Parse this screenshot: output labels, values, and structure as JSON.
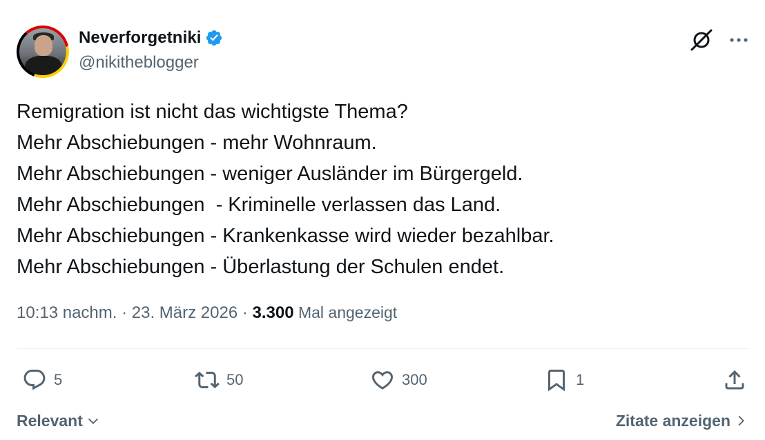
{
  "author": {
    "display_name": "Neverforgetniki",
    "handle": "@nikitheblogger",
    "verified": true
  },
  "tweet": {
    "lines": [
      "Remigration ist nicht das wichtigste Thema?",
      "Mehr Abschiebungen - mehr Wohnraum.",
      "Mehr Abschiebungen - weniger Ausländer im Bürgergeld.",
      "Mehr Abschiebungen  - Kriminelle verlassen das Land.",
      "Mehr Abschiebungen - Krankenkasse wird wieder bezahlbar.",
      "Mehr Abschiebungen - Überlastung der Schulen endet."
    ]
  },
  "meta": {
    "time": "10:13 nachm.",
    "sep1": " · ",
    "date": "23. März 2026",
    "sep2": " · ",
    "views_count": "3.300",
    "views_label": " Mal angezeigt"
  },
  "actions": {
    "replies": "5",
    "reposts": "50",
    "likes": "300",
    "bookmarks": "1"
  },
  "footer": {
    "sort_label": "Relevant",
    "quotes_label": "Zitate anzeigen"
  },
  "icons": {
    "verified": "verified-badge-icon",
    "grok": "grok-icon",
    "more": "more-icon",
    "reply": "reply-icon",
    "retweet": "retweet-icon",
    "like": "heart-icon",
    "bookmark": "bookmark-icon",
    "share": "share-icon"
  },
  "colors": {
    "verified": "#1d9bf0",
    "muted": "#536471",
    "text": "#0f1419"
  }
}
